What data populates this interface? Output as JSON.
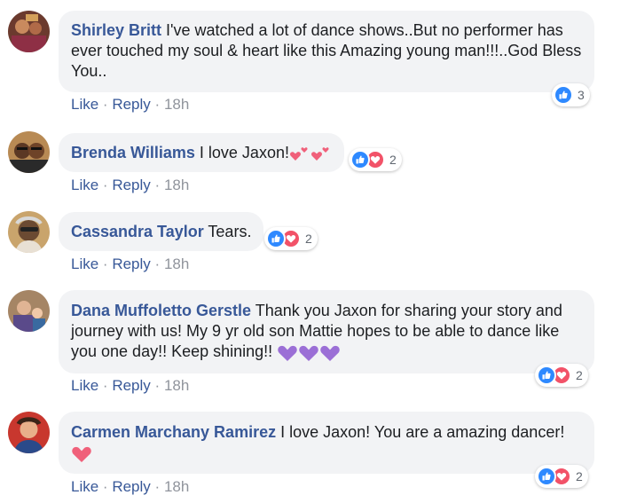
{
  "comments": [
    {
      "author": "Shirley Britt",
      "text": "I've watched a lot of dance shows..But no performer has ever touched my soul & heart like this Amazing young man!!!..God Bless You..",
      "actions": {
        "like": "Like",
        "reply": "Reply",
        "time": "18h"
      },
      "reactions": {
        "count": "3",
        "types": [
          "like"
        ]
      }
    },
    {
      "author": "Brenda Williams",
      "text": "I love Jaxon!",
      "actions": {
        "like": "Like",
        "reply": "Reply",
        "time": "18h"
      },
      "reactions": {
        "count": "2",
        "types": [
          "like",
          "love"
        ]
      },
      "emoji": [
        "two-hearts",
        "two-hearts"
      ]
    },
    {
      "author": "Cassandra Taylor",
      "text": "Tears.",
      "actions": {
        "like": "Like",
        "reply": "Reply",
        "time": "18h"
      },
      "reactions": {
        "count": "2",
        "types": [
          "like",
          "love"
        ]
      }
    },
    {
      "author": "Dana Muffoletto Gerstle",
      "text": "Thank you Jaxon for sharing your story and journey with us! My 9 yr old son Mattie hopes to be able to dance like you one day!! Keep shining!!",
      "actions": {
        "like": "Like",
        "reply": "Reply",
        "time": "18h"
      },
      "reactions": {
        "count": "2",
        "types": [
          "like",
          "love"
        ]
      },
      "emoji": [
        "purple-heart",
        "purple-heart",
        "purple-heart"
      ]
    },
    {
      "author": "Carmen Marchany Ramirez",
      "text": "I love Jaxon! You are a amazing dancer!",
      "actions": {
        "like": "Like",
        "reply": "Reply",
        "time": "18h"
      },
      "reactions": {
        "count": "2",
        "types": [
          "like",
          "love"
        ]
      },
      "emoji": [
        "red-heart"
      ]
    }
  ],
  "separator": "·",
  "colors": {
    "author": "#385898",
    "bubble": "#f2f3f5",
    "like": "#2e89ff",
    "love": "#f25268",
    "purple_heart": "#9b6fd6"
  }
}
